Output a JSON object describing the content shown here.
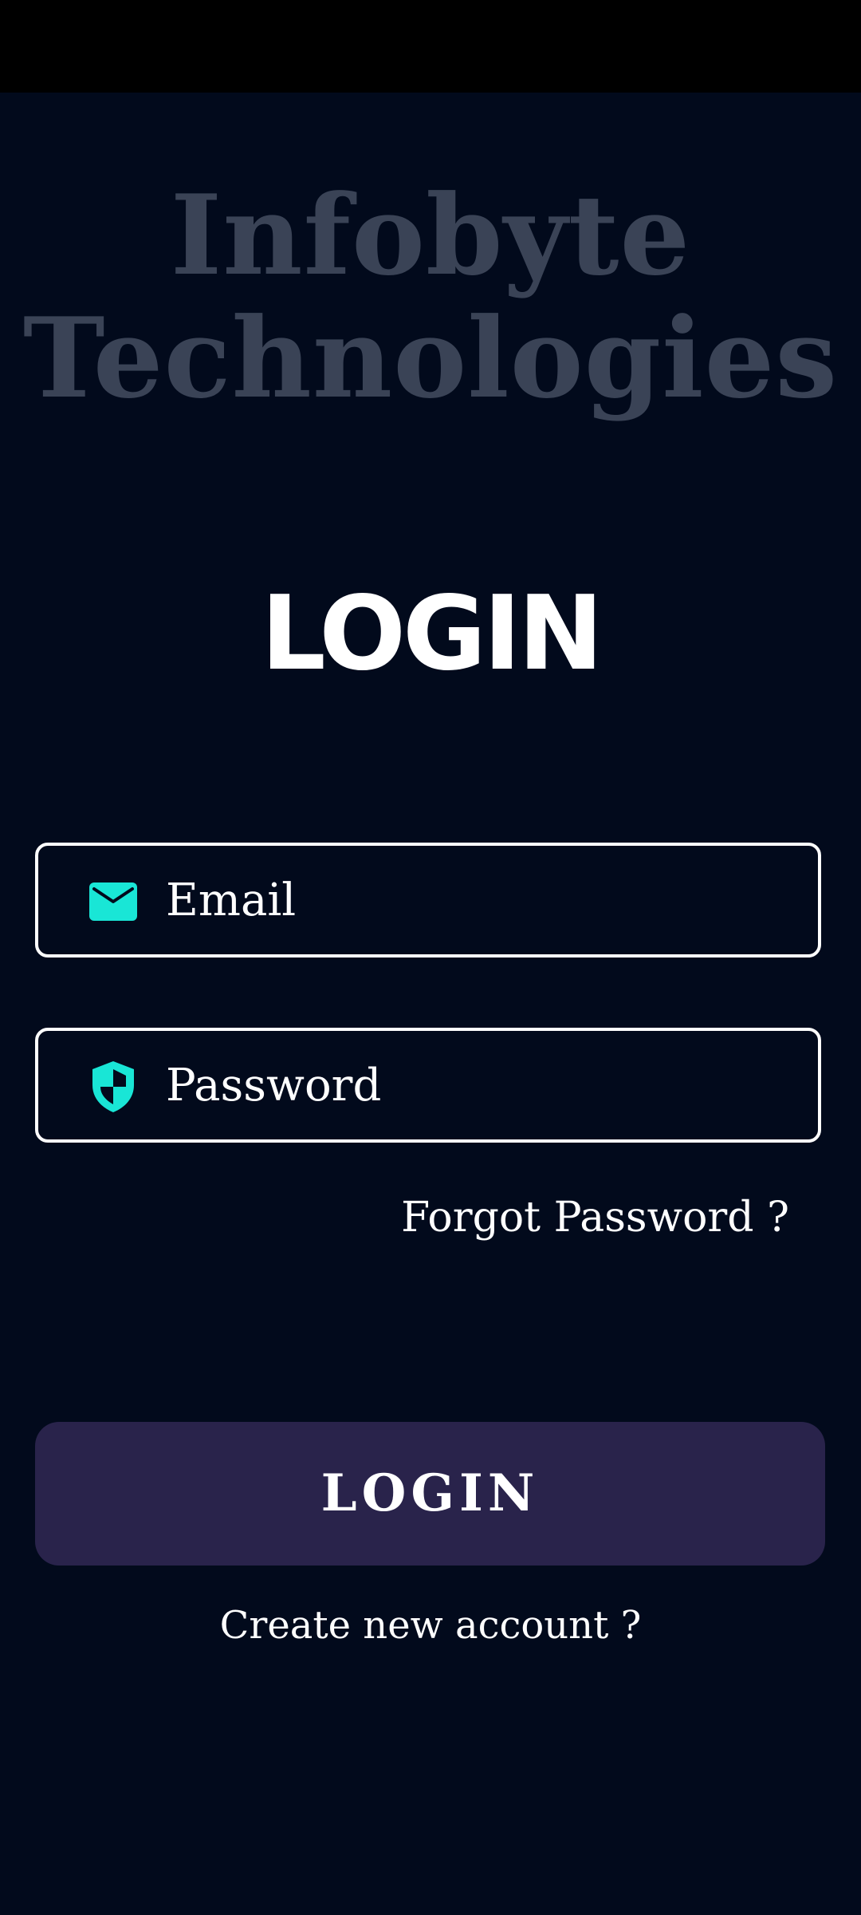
{
  "brand": {
    "line1": "Infobyte",
    "line2": "Technologies"
  },
  "title": "LOGIN",
  "form": {
    "email": {
      "placeholder": "Email",
      "value": "",
      "icon": "mail-icon"
    },
    "password": {
      "placeholder": "Password",
      "value": "",
      "icon": "shield-icon"
    },
    "forgot_label": "Forgot Password ?",
    "submit_label": "LOGIN",
    "create_account_label": "Create new account ?"
  },
  "colors": {
    "background": "#020a1c",
    "brand_text": "#3a4356",
    "accent_icon": "#19e6d6",
    "button": "#29234b",
    "text": "#ffffff"
  }
}
